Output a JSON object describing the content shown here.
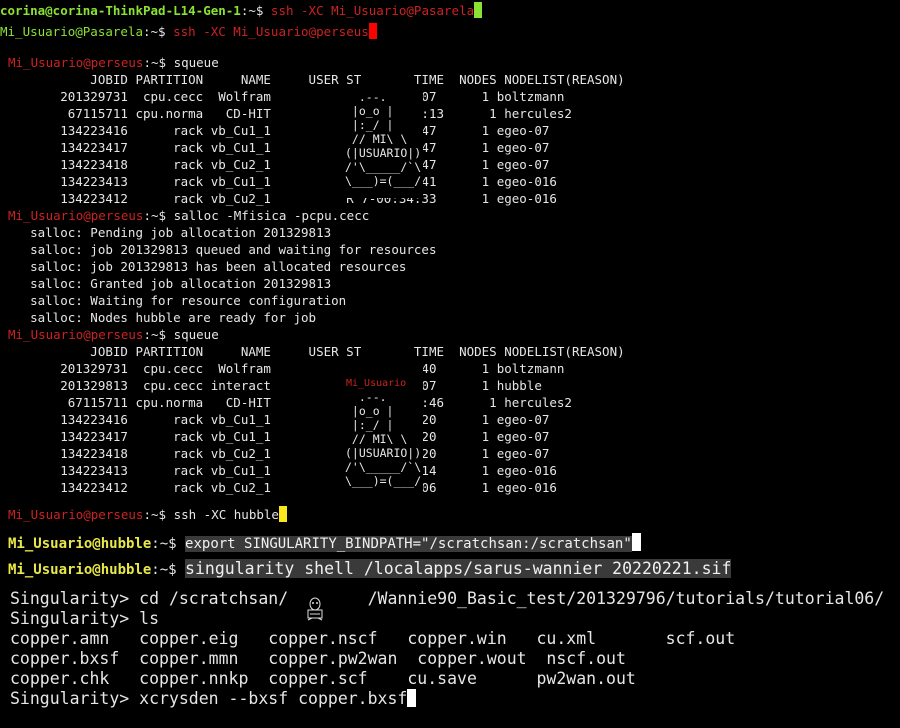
{
  "term": {
    "l01": {
      "user": "corina@corina-ThinkPad-L14-Gen-1",
      "sep": ":~$",
      "cmd": " ssh -XC Mi_Usuario@Pasarela"
    },
    "l02": {
      "user": "Mi_Usuario@Pasarela",
      "sep": ":~$",
      "cmd": " ssh -XC Mi_Usuario@perseus"
    },
    "l03": {
      "user": "Mi_Usuario@perseus",
      "sep": ":~$",
      "cmd": " squeue"
    },
    "q1": [
      "            JOBID PARTITION     NAME     USER ST       TIME  NODES NODELIST(REASON)",
      "        201329731  cpu.cecc  Wolfram          R 2-22:43:07      1 boltzmann",
      "         67115711 cpu.norma   CD-HIT          R 11-04:49:13      1 hercules2",
      "        134223416      rack vb_Cu1_1          R    7:39:47      1 egeo-07",
      "        134223417      rack vb_Cu1_1          R    7:39:47      1 egeo-07",
      "        134223418      rack vb_Cu2_1          R    7:39:47      1 egeo-07",
      "        134223413      rack vb_Cu1_1          R 7-00:12:41      1 egeo-016",
      "        134223412      rack vb_Cu2_1          R 7-00:34:33      1 egeo-016"
    ],
    "l04": {
      "user": "Mi_Usuario@perseus",
      "sep": ":~$",
      "cmd": " salloc -Mfisica -pcpu.cecc"
    },
    "salloc": [
      "    salloc: Pending job allocation 201329813",
      "    salloc: job 201329813 queued and waiting for resources",
      "    salloc: job 201329813 has been allocated resources",
      "    salloc: Granted job allocation 201329813",
      "    salloc: Waiting for resource configuration",
      "    salloc: Nodes hubble are ready for job"
    ],
    "l05": {
      "user": "Mi_Usuario@perseus",
      "sep": ":~$",
      "cmd": " squeue"
    },
    "q2": [
      "            JOBID PARTITION     NAME     USER ST       TIME  NODES NODELIST(REASON)",
      "        201329731  cpu.cecc  Wolfram          R 2-22:43:40      1 boltzmann",
      "        201329813  cpu.cecc interact          R       0:07      1 hubble",
      "         67115711 cpu.norma   CD-HIT          R 11-04:49:46      1 hercules2",
      "        134223416      rack vb_Cu1_1          R    7:40:20      1 egeo-07",
      "        134223417      rack vb_Cu1_1          R    7:40:20      1 egeo-07",
      "        134223418      rack vb_Cu2_1          R    7:40:20      1 egeo-07",
      "        134223413      rack vb_Cu1_1          R 7-00:13:14      1 egeo-016",
      "        134223412      rack vb_Cu2_1          R 7-00:35:06      1 egeo-016"
    ],
    "l06": {
      "user": "Mi_Usuario@perseus",
      "sep": ":~$",
      "cmd": " ssh -XC hubble"
    },
    "l07": {
      "user": "Mi_Usuario@hubble",
      "sep": ":~$",
      "cmd": "export SINGULARITY_BINDPATH=\"/scratchsan:/scratchsan\""
    },
    "l08": {
      "user": "Mi_Usuario@hubble",
      "sep": ":~$",
      "cmd": "singularity shell /localapps/sarus-wannier 20220221.sif"
    },
    "s1": "Singularity> cd /scratchsan/        /Wannie90_Basic_test/201329796/tutorials/tutorial06/",
    "s2": "Singularity> ls",
    "ls": [
      "copper.amn   copper.eig   copper.nscf   copper.win   cu.xml       scf.out",
      "copper.bxsf  copper.mmn   copper.pw2wan  copper.wout  nscf.out",
      "copper.chk   copper.nnkp  copper.scf    cu.save      pw2wan.out"
    ],
    "s3": "Singularity> xcrysden --bxsf copper.bxsf"
  },
  "mascot": {
    "art1": "  .--.\n |o_o |\n |:_/ |\n // MI\\ \\\n(|USUARIO|)\n/'\\_____/`\\\n\\___)=(___/",
    "label2": "Mi_Usuario",
    "art2": "  .--.\n |o_o |\n |:_/ |\n // MI\\ \\\n(|USUARIO|)\n/'\\_____/`\\\n\\___)=(___/"
  },
  "colors": {
    "prompt_user": "#8ae234",
    "prompt_path": "#729fcf",
    "hidden_user": "#cc2222",
    "background": "#000000"
  }
}
